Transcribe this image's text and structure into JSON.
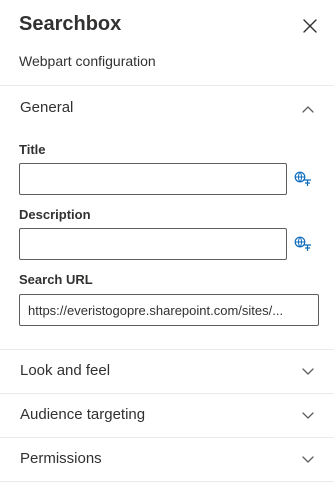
{
  "header": {
    "title": "Searchbox",
    "subtitle": "Webpart configuration"
  },
  "sections": {
    "general": {
      "label": "General",
      "expanded": true,
      "fields": {
        "title": {
          "label": "Title",
          "value": ""
        },
        "description": {
          "label": "Description",
          "value": ""
        },
        "search_url": {
          "label": "Search URL",
          "value": "https://everistogopre.sharepoint.com/sites/..."
        }
      }
    },
    "look_and_feel": {
      "label": "Look and feel",
      "expanded": false
    },
    "audience_targeting": {
      "label": "Audience targeting",
      "expanded": false
    },
    "permissions": {
      "label": "Permissions",
      "expanded": false
    }
  },
  "icons": {
    "close": "close-icon",
    "collapse": "chevron-up-icon",
    "expand": "chevron-down-icon",
    "translate": "translate-icon"
  },
  "colors": {
    "text": "#323130",
    "divider": "#edebe9",
    "input_border": "#605e5c",
    "accent": "#0f6cbd"
  }
}
